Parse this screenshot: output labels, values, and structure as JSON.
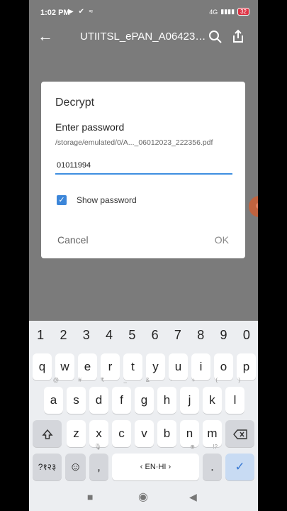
{
  "status_bar": {
    "time": "1:02 PM",
    "left_icons": "▶ ✔ ≈",
    "network": "4G",
    "signal": "▮▮▮▮",
    "battery": "32"
  },
  "toolbar": {
    "title": "UTIITSL_ePAN_A064236..."
  },
  "dialog": {
    "title": "Decrypt",
    "prompt": "Enter password",
    "path": "/storage/emulated/0/A..._06012023_222356.pdf",
    "password_value": "01011994",
    "show_password_label": "Show password",
    "show_password_checked": true,
    "cancel_label": "Cancel",
    "ok_label": "OK"
  },
  "keyboard": {
    "numbers": [
      "1",
      "2",
      "3",
      "4",
      "5",
      "6",
      "7",
      "8",
      "9",
      "0"
    ],
    "row1": [
      "q",
      "w",
      "e",
      "r",
      "t",
      "y",
      "u",
      "i",
      "o",
      "p"
    ],
    "row2": [
      "a",
      "s",
      "d",
      "f",
      "g",
      "h",
      "j",
      "k",
      "l"
    ],
    "row2_hints": [
      "@",
      "#",
      "₹",
      "_",
      "&",
      "-",
      "+",
      "(",
      ")"
    ],
    "row3": [
      "z",
      "x",
      "c",
      "v",
      "b",
      "n",
      "m"
    ],
    "symbols_label": "?१२३",
    "comma": ",",
    "space_label": "EN·HI",
    "period": ".",
    "period_hint": "!?",
    "accent_color": "#3a7ad4"
  }
}
